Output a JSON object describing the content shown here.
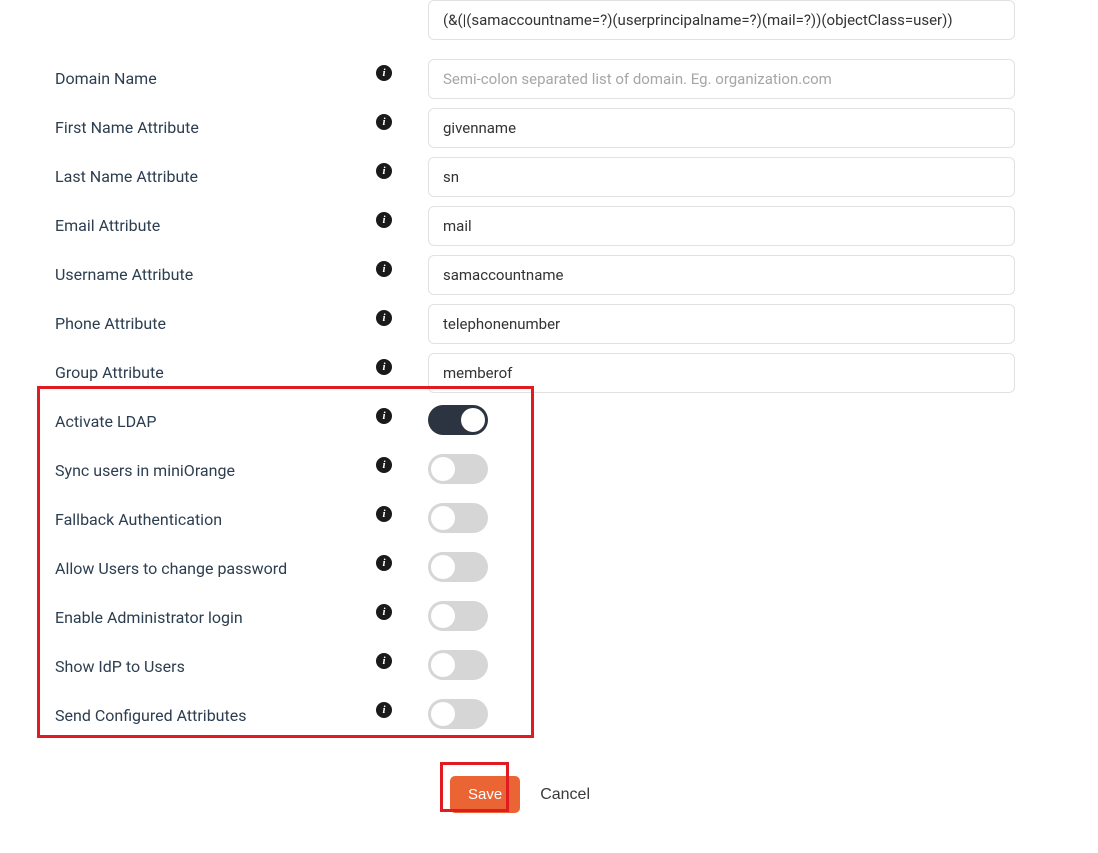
{
  "fields": {
    "filter_value": "(&(|(samaccountname=?)(userprincipalname=?)(mail=?))(objectClass=user))",
    "domain_name": {
      "label": "Domain Name",
      "value": "",
      "placeholder": "Semi-colon separated list of domain. Eg. organization.com"
    },
    "first_name_attr": {
      "label": "First Name Attribute",
      "value": "givenname"
    },
    "last_name_attr": {
      "label": "Last Name Attribute",
      "value": "sn"
    },
    "email_attr": {
      "label": "Email Attribute",
      "value": "mail"
    },
    "username_attr": {
      "label": "Username Attribute",
      "value": "samaccountname"
    },
    "phone_attr": {
      "label": "Phone Attribute",
      "value": "telephonenumber"
    },
    "group_attr": {
      "label": "Group Attribute",
      "value": "memberof"
    }
  },
  "toggles": {
    "activate_ldap": {
      "label": "Activate LDAP",
      "on": true
    },
    "sync_users": {
      "label": "Sync users in miniOrange",
      "on": false
    },
    "fallback_auth": {
      "label": "Fallback Authentication",
      "on": false
    },
    "allow_pw_change": {
      "label": "Allow Users to change password",
      "on": false
    },
    "enable_admin_login": {
      "label": "Enable Administrator login",
      "on": false
    },
    "show_idp": {
      "label": "Show IdP to Users",
      "on": false
    },
    "send_configured_attrs": {
      "label": "Send Configured Attributes",
      "on": false
    }
  },
  "actions": {
    "save": "Save",
    "cancel": "Cancel"
  },
  "info_glyph": "i"
}
